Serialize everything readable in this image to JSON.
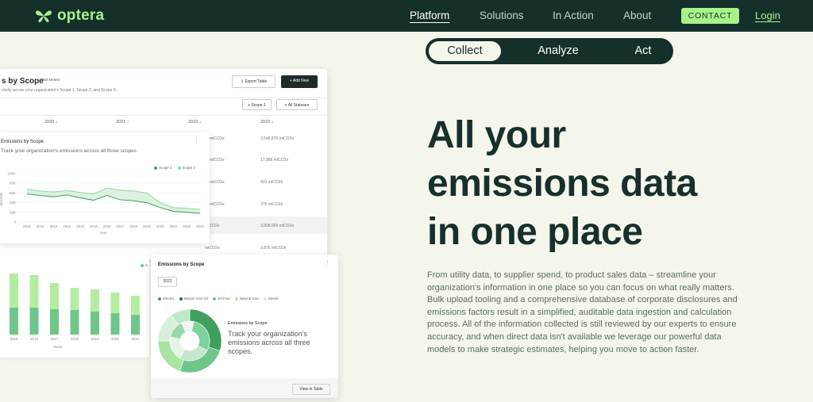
{
  "brand": {
    "name": "optera",
    "accent": "#a8f28a",
    "dark": "#15302b"
  },
  "nav": {
    "links": [
      "Platform",
      "Solutions",
      "In Action",
      "About"
    ],
    "active": "Platform",
    "contact": "CONTACT",
    "login": "Login"
  },
  "toggle": {
    "options": [
      "Collect",
      "Analyze",
      "Act"
    ],
    "active": "Collect"
  },
  "hero": {
    "headline_lines": [
      "All your",
      "emissions data",
      "in one place"
    ],
    "body": "From utility data, to supplier spend, to product sales data – streamline your organization's information in one place so you can focus on what really matters. Bulk upload tooling and a comprehensive database of corporate disclosures and emissions factors result in a simplified, auditable data ingestion and calculation process. All of the information collected is still reviewed by our experts to ensure accuracy, and when direct data isn't available we leverage our powerful data models to make strategic estimates, helping you move to action faster."
  },
  "table_card": {
    "title": "s by Scope",
    "meters": "2,350 Meters",
    "subtitle": "ctivity across your organization's Scope 1, Scope 2, and Scope 3.",
    "export": "Export Table",
    "add_new": "Add New",
    "filter_scope": "Scope 1",
    "filter_status": "All Statuses",
    "headers": [
      "2020 ↓",
      "2021 ↑",
      "2022 ↓",
      "2022 ↓"
    ],
    "col3": [
      "mtCO2e",
      "mtCO2e",
      "mtCO2e",
      "mtCO2e",
      "mtCO2e",
      "mtCO2e"
    ],
    "col4": [
      "3,546,876 mtCO2e",
      "17,989 mtCO2e",
      "433 mtCO2e",
      "376 mtCO2e",
      "3,908,969 mtCO2e",
      "3,876 mtCO2e"
    ]
  },
  "line_card": {
    "title": "Emissions by Scope",
    "subtitle": "Track your organization's emissions across all three scopes",
    "legend": [
      "Scope 1",
      "Scope 2"
    ],
    "y_axis_label": "mtCO2e",
    "x_axis_label": "Year"
  },
  "bar_card": {
    "legend_fragment": "S",
    "x_axis_label": "Years"
  },
  "donut_card": {
    "title": "Emissions by Scope",
    "year": "2022",
    "legend": [
      "Electric",
      "Marine Gas Oil",
      "Jet Fuel",
      "Natural Gas",
      "Diesel"
    ],
    "label": "Emissions by Scope",
    "subtitle": "Track your organization's emissions across all three scopes.",
    "view_button": "View in Table"
  },
  "colors": {
    "dark_green": "#3f9f5f",
    "mid_green": "#6fc68a",
    "light_green": "#a9e4a0",
    "pale": "#d8efdc"
  },
  "chart_data": [
    {
      "type": "line",
      "title": "Emissions by Scope",
      "x": [
        2010,
        2011,
        2012,
        2013,
        2014,
        2015,
        2016,
        2017,
        2018,
        2019,
        2020,
        2021,
        2022,
        2023
      ],
      "series": [
        {
          "name": "Scope 1",
          "values": [
            58,
            55,
            52,
            56,
            50,
            45,
            55,
            46,
            44,
            40,
            30,
            22,
            20,
            18
          ]
        },
        {
          "name": "Scope 2",
          "values": [
            68,
            64,
            62,
            65,
            61,
            58,
            70,
            66,
            64,
            60,
            40,
            30,
            28,
            26
          ]
        }
      ],
      "xlabel": "Year",
      "ylabel": "mtCO2e",
      "yticks": [
        "100K",
        "80K",
        "60K",
        "40K",
        "20K",
        "0"
      ],
      "ylim": [
        0,
        100
      ]
    },
    {
      "type": "bar",
      "categories": [
        "2015",
        "2016",
        "2017",
        "2018",
        "2019",
        "2020",
        "2021"
      ],
      "series": [
        {
          "values": [
            43,
            41,
            33,
            28,
            28,
            26,
            24
          ]
        },
        {
          "values": [
            34,
            34,
            32,
            31,
            29,
            27,
            25
          ]
        }
      ],
      "xlabel": "Years"
    },
    {
      "type": "pie",
      "title": "Emissions by Scope",
      "labels": [
        "Electric",
        "Marine Gas Oil",
        "Jet Fuel",
        "Natural Gas",
        "Diesel"
      ],
      "values": [
        30,
        25,
        20,
        15,
        10
      ]
    }
  ]
}
